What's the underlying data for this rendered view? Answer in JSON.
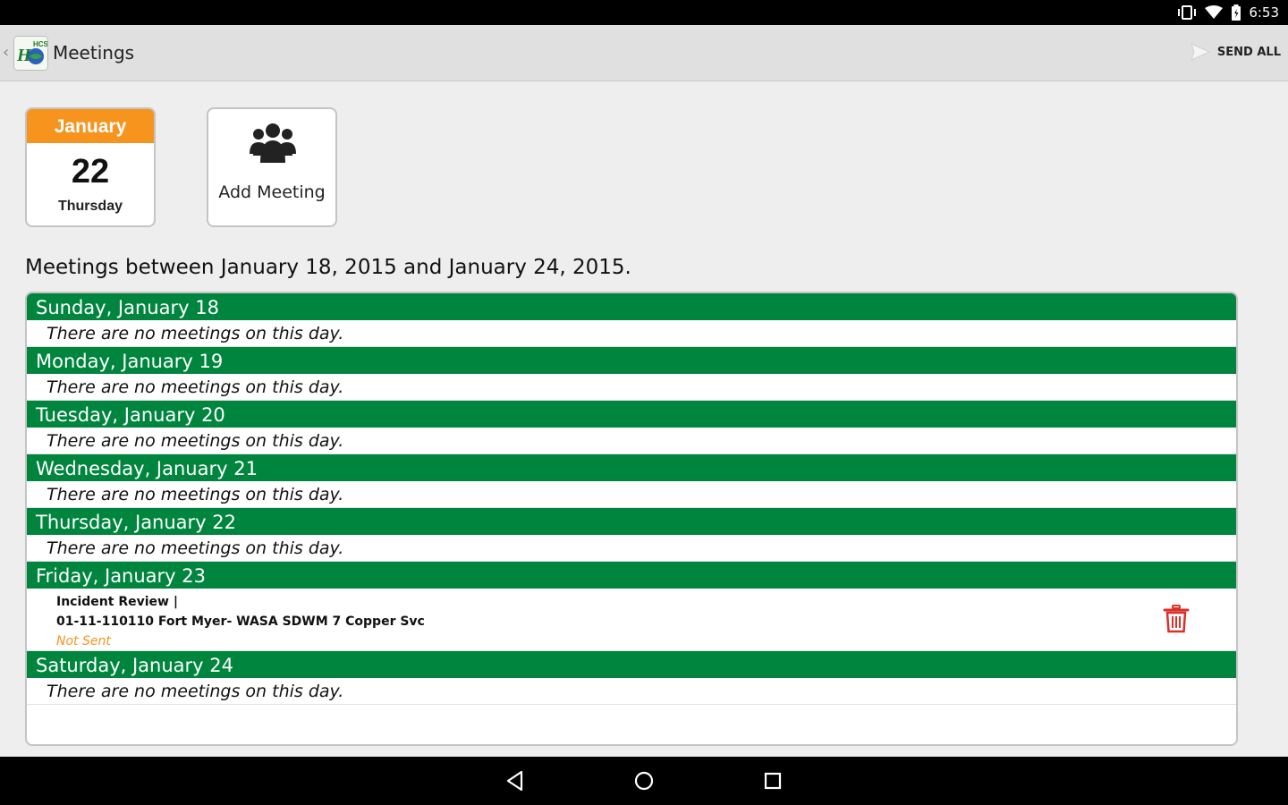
{
  "status_bar": {
    "time": "6:53",
    "icons": [
      "vibrate-icon",
      "wifi-icon",
      "battery-icon"
    ]
  },
  "app_bar": {
    "title": "Meetings",
    "send_all_label": "SEND ALL",
    "logo_text": "HCSS"
  },
  "date_card": {
    "month": "January",
    "day": "22",
    "weekday": "Thursday"
  },
  "add_meeting": {
    "label": "Add Meeting"
  },
  "range_text": "Meetings between January 18, 2015 and January 24, 2015.",
  "days": [
    {
      "header": "Sunday, January 18",
      "empty_text": "There are no meetings on this day."
    },
    {
      "header": "Monday, January 19",
      "empty_text": "There are no meetings on this day."
    },
    {
      "header": "Tuesday, January 20",
      "empty_text": "There are no meetings on this day."
    },
    {
      "header": "Wednesday, January 21",
      "empty_text": "There are no meetings on this day."
    },
    {
      "header": "Thursday, January 22",
      "empty_text": "There are no meetings on this day."
    },
    {
      "header": "Friday, January 23",
      "meeting": {
        "type": "Incident Review |",
        "name": "01-11-110110 Fort Myer- WASA SDWM 7 Copper Svc",
        "status": "Not Sent"
      }
    },
    {
      "header": "Saturday, January 24",
      "empty_text": "There are no meetings on this day."
    }
  ],
  "colors": {
    "accent_orange": "#f7941d",
    "header_green": "#00853e",
    "delete_red": "#d9302a"
  },
  "nav_bar": {
    "icons": [
      "back-icon",
      "home-icon",
      "recents-icon"
    ]
  }
}
